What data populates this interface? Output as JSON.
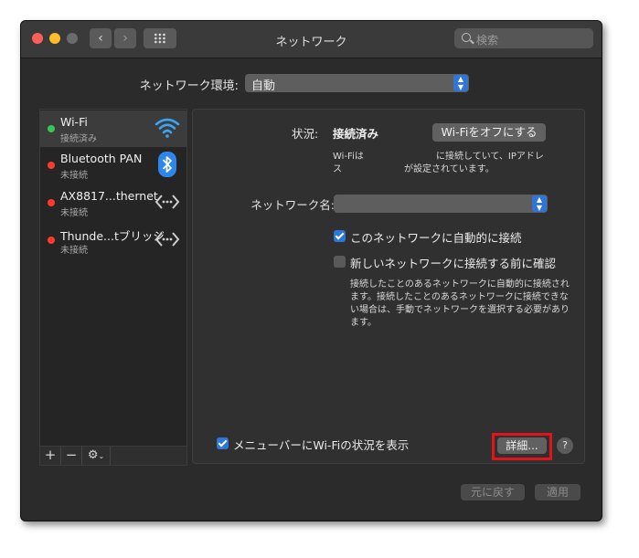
{
  "window": {
    "title": "ネットワーク",
    "search_placeholder": "検索",
    "nav_back": "‹",
    "nav_forward": "›"
  },
  "location": {
    "label": "ネットワーク環境:",
    "value": "自動"
  },
  "services": [
    {
      "name": "Wi-Fi",
      "status": "接続済み",
      "status_color": "#35c759",
      "icon": "wifi-icon",
      "selected": true
    },
    {
      "name": "Bluetooth PAN",
      "status": "未接続",
      "status_color": "#ff3b30",
      "icon": "bluetooth-icon",
      "selected": false
    },
    {
      "name": "AX8817...thernet",
      "status": "未接続",
      "status_color": "#ff3b30",
      "icon": "ethernet-arrows-icon",
      "selected": false
    },
    {
      "name": "Thunde...tブリッジ",
      "status": "未接続",
      "status_color": "#ff3b30",
      "icon": "ethernet-arrows-icon",
      "selected": false
    }
  ],
  "sidebar_tools": {
    "add": "+",
    "remove": "−",
    "gear": "⚙"
  },
  "detail": {
    "status_label": "状況:",
    "status_value": "接続済み",
    "wifi_off_button": "Wi-Fiをオフにする",
    "status_desc_line1_a": "Wi-Fiは",
    "status_desc_line1_b": "に接続していて、IPアドレ",
    "status_desc_line2_a": "ス",
    "status_desc_line2_b": "が設定されています。",
    "network_name_label": "ネットワーク名:",
    "network_name_value": "",
    "auto_join_label": "このネットワークに自動的に接続",
    "auto_join_checked": true,
    "ask_join_label": "新しいネットワークに接続する前に確認",
    "ask_join_checked": false,
    "help_line1": "接続したことのあるネットワークに自動的に接続され",
    "help_line2": "ます。接続したことのあるネットワークに接続できな",
    "help_line3": "い場合は、手動でネットワークを選択する必要があり",
    "help_line4": "ます。",
    "menubar_label": "メニューバーにWi-Fiの状況を表示",
    "menubar_checked": true,
    "advanced_button": "詳細...",
    "help_button": "?"
  },
  "footer": {
    "revert_button": "元に戻す",
    "apply_button": "適用"
  },
  "colors": {
    "accent": "#2f76d6",
    "highlight_box": "#e0141a"
  }
}
